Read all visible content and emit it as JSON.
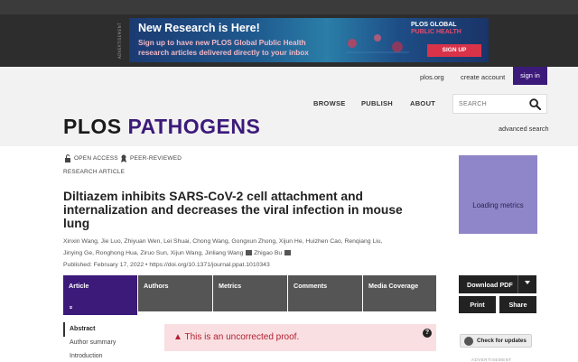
{
  "ad": {
    "vertical_label": "ADVERTISEMENT",
    "title": "New Research is Here!",
    "subtitle": "Sign up to have new PLOS Global Public Health research articles delivered directly to your inbox",
    "brand_line1": "PLOS GLOBAL",
    "brand_line2": "PUBLIC HEALTH",
    "signup_label": "SIGN UP"
  },
  "header": {
    "util_links": [
      "plos.org",
      "create account"
    ],
    "signin_label": "sign in",
    "logo_plos": "PLOS",
    "logo_journal": "PATHOGENS",
    "nav": [
      "BROWSE",
      "PUBLISH",
      "ABOUT"
    ],
    "search_placeholder": "SEARCH",
    "advanced_search": "advanced search"
  },
  "article": {
    "open_access": "OPEN ACCESS",
    "peer_reviewed": "PEER-REVIEWED",
    "type": "RESEARCH ARTICLE",
    "title": "Diltiazem inhibits SARS-CoV-2 cell attachment and internalization and decreases the viral infection in mouse lung",
    "authors_line1": "Xinxin Wang,  Jie Luo,  Zhiyuan Wen,  Lei Shuai,  Chong Wang,  Gongxun Zhong,  Xijun He,  Huizhen Cao,  Renqiang Liu,",
    "authors_line2a": "Jinying Ge,  Ronghong Hua,  Ziruo Sun,  Xijun Wang,  Jinliang Wang",
    "authors_line2b": "Zhigao Bu",
    "published": "Published: February 17, 2022  •  https://doi.org/10.1371/journal.ppat.1010343"
  },
  "tabs": [
    {
      "label": "Article",
      "active": true
    },
    {
      "label": "Authors",
      "active": false
    },
    {
      "label": "Metrics",
      "active": false
    },
    {
      "label": "Comments",
      "active": false
    },
    {
      "label": "Media Coverage",
      "active": false
    }
  ],
  "tab_chevron": "»",
  "sidebar": {
    "items": [
      "Abstract",
      "Author summary",
      "Introduction"
    ]
  },
  "proof": {
    "text": "▲ This is an uncorrected proof.",
    "help": "?"
  },
  "right": {
    "metrics_label": "Loading metrics",
    "download_label": "Download PDF",
    "print_label": "Print",
    "share_label": "Share",
    "check_updates": "Check for updates",
    "advert_label": "ADVERTISEMENT"
  },
  "colors": {
    "brand_purple": "#3c1a7a",
    "proof_bg": "#f9dfe2",
    "proof_text": "#b11f2f",
    "metrics_bg": "#8e86c8"
  }
}
